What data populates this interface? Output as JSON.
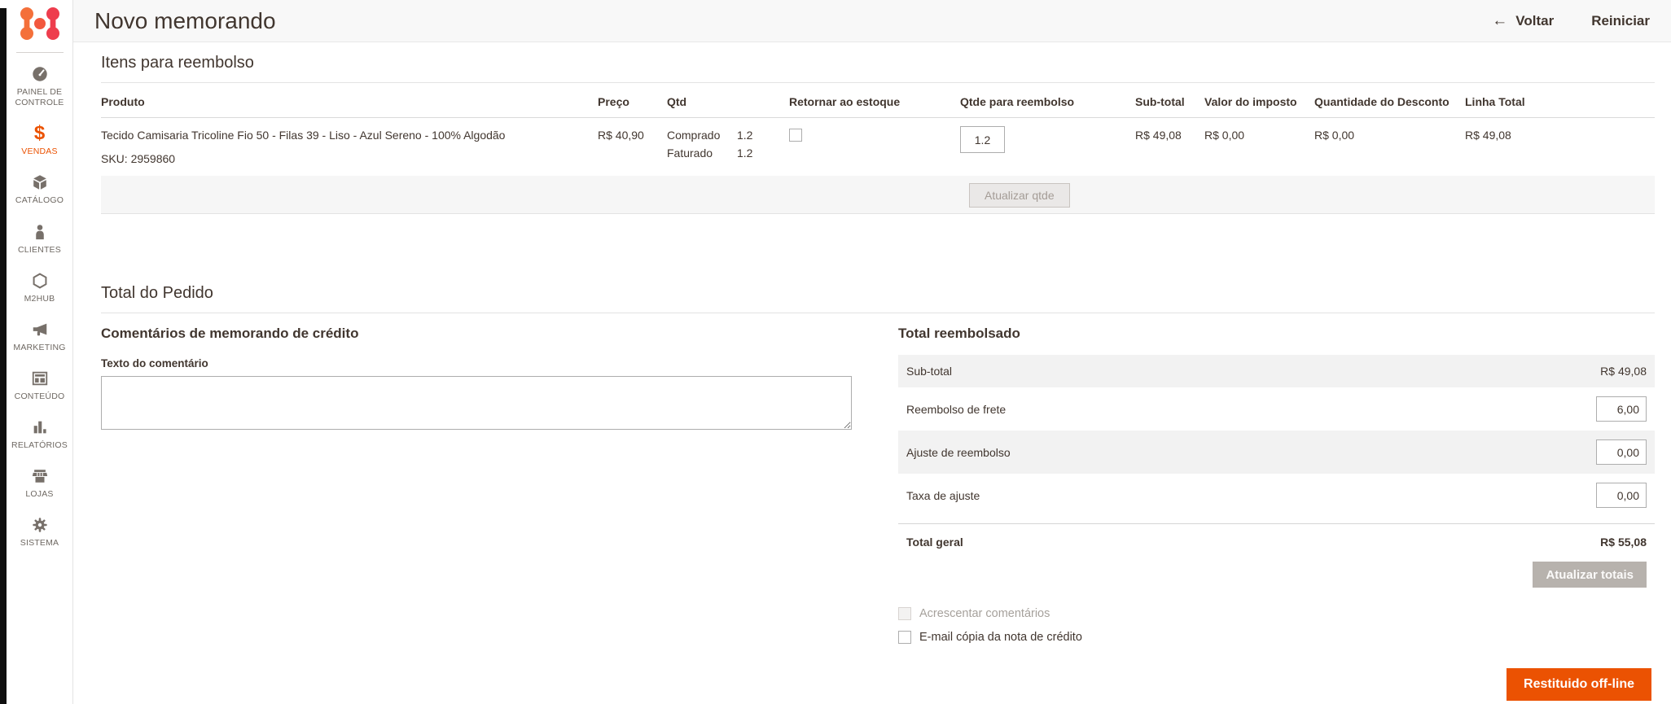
{
  "icons": {
    "back_arrow": "←",
    "sales_dollar": "$"
  },
  "header": {
    "title": "Novo memorando",
    "back_label": "Voltar",
    "reset_label": "Reiniciar"
  },
  "sidebar": {
    "items": [
      {
        "label": "PAINEL DE CONTROLE",
        "icon": "dashboard-icon"
      },
      {
        "label": "VENDAS",
        "icon": "sales-icon",
        "active": true,
        "accent": "#eb5202"
      },
      {
        "label": "CATÁLOGO",
        "icon": "catalog-icon"
      },
      {
        "label": "CLIENTES",
        "icon": "customers-icon"
      },
      {
        "label": "M2HUB",
        "icon": "m2hub-icon"
      },
      {
        "label": "MARKETING",
        "icon": "marketing-icon"
      },
      {
        "label": "CONTEÚDO",
        "icon": "content-icon"
      },
      {
        "label": "RELATÓRIOS",
        "icon": "reports-icon"
      },
      {
        "label": "LOJAS",
        "icon": "stores-icon"
      },
      {
        "label": "SISTEMA",
        "icon": "system-icon"
      }
    ]
  },
  "items_section": {
    "title": "Itens para reembolso",
    "table": {
      "columns": [
        "Produto",
        "Preço",
        "Qtd",
        "Retornar ao estoque",
        "Qtde para reembolso",
        "Sub-total",
        "Valor do imposto",
        "Quantidade do Desconto",
        "Linha Total"
      ],
      "row": {
        "product_name": "Tecido Camisaria Tricoline Fio 50 - Filas 39 - Liso - Azul Sereno - 100% Algodão",
        "sku": "SKU: 2959860",
        "price": "R$ 40,90",
        "qty_lines": [
          {
            "label": "Comprado",
            "value": "1.2"
          },
          {
            "label": "Faturado",
            "value": "1.2"
          }
        ],
        "return_to_stock_checked": false,
        "qty_to_refund": "1.2",
        "subtotal": "R$ 49,08",
        "tax_amount": "R$ 0,00",
        "discount_amount": "R$ 0,00",
        "row_total": "R$ 49,08"
      },
      "update_qty_label": "Atualizar qtde"
    }
  },
  "order_total_section": {
    "title": "Total do Pedido",
    "comments": {
      "title": "Comentários de memorando de crédito",
      "comment_label": "Texto do comentário",
      "comment_value": ""
    },
    "totals": {
      "title": "Total reembolsado",
      "rows": [
        {
          "label": "Sub-total",
          "value": "R$ 49,08"
        },
        {
          "label": "Reembolso de frete",
          "value": "6,00"
        },
        {
          "label": "Ajuste de reembolso",
          "value": "0,00"
        },
        {
          "label": "Taxa de ajuste",
          "value": "0,00"
        }
      ],
      "grand_total_label": "Total geral",
      "grand_total_value": "R$ 55,08",
      "update_totals_label": "Atualizar totais",
      "checkboxes": [
        {
          "label": "Acrescentar comentários",
          "disabled": true,
          "checked": false
        },
        {
          "label": "E-mail cópia da nota de crédito",
          "disabled": false,
          "checked": false
        }
      ],
      "submit_label": "Restituido off-line",
      "submit_color": "#eb5202"
    }
  }
}
